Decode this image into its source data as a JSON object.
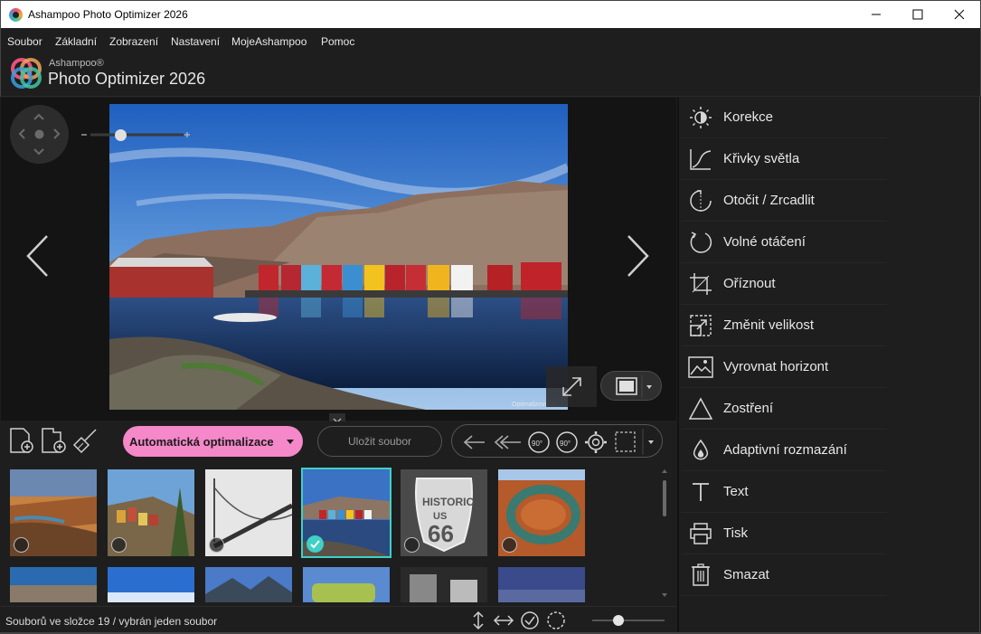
{
  "window": {
    "title": "Ashampoo Photo Optimizer 2026"
  },
  "menu": [
    "Soubor",
    "Základní",
    "Zobrazení",
    "Nastavení",
    "MojeAshampoo",
    "Pomoc"
  ],
  "brand": {
    "small": "Ashampoo®",
    "large": "Photo Optimizer 2026"
  },
  "viewer": {
    "watermark": "Optimalizováno"
  },
  "toolbar": {
    "auto_label": "Automatická optimalizace",
    "save_label": "Uložit soubor",
    "rotate_left_label": "90°",
    "rotate_right_label": "90°"
  },
  "thumbnails_row1": [
    {
      "name": "canyon-river",
      "selected": false
    },
    {
      "name": "coastal-village",
      "selected": false
    },
    {
      "name": "foggy-bridge",
      "selected": false
    },
    {
      "name": "harbor-houses",
      "selected": true
    },
    {
      "name": "route-66",
      "selected": false
    },
    {
      "name": "horseshoe-bend",
      "selected": false
    }
  ],
  "panel": {
    "items": [
      {
        "label": "Korekce",
        "icon": "sun-icon"
      },
      {
        "label": "Křivky světla",
        "icon": "curve-icon"
      },
      {
        "label": "Otočit / Zrcadlit",
        "icon": "rotate-mirror-icon"
      },
      {
        "label": "Volné otáčení",
        "icon": "free-rotate-icon"
      },
      {
        "label": "Oříznout",
        "icon": "crop-icon"
      },
      {
        "label": "Změnit velikost",
        "icon": "resize-icon"
      },
      {
        "label": "Vyrovnat horizont",
        "icon": "horizon-icon"
      },
      {
        "label": "Zostření",
        "icon": "sharpen-icon"
      },
      {
        "label": "Adaptivní rozmazání",
        "icon": "blur-drop-icon"
      },
      {
        "label": "Text",
        "icon": "text-icon"
      },
      {
        "label": "Tisk",
        "icon": "printer-icon"
      },
      {
        "label": "Smazat",
        "icon": "trash-icon"
      }
    ]
  },
  "status": {
    "text": "Souborů ve složce 19 / vybrán jeden soubor"
  },
  "colors": {
    "accent_pink": "#f488c8",
    "selection_teal": "#3fd0c6",
    "background": "#1e1e1e"
  }
}
